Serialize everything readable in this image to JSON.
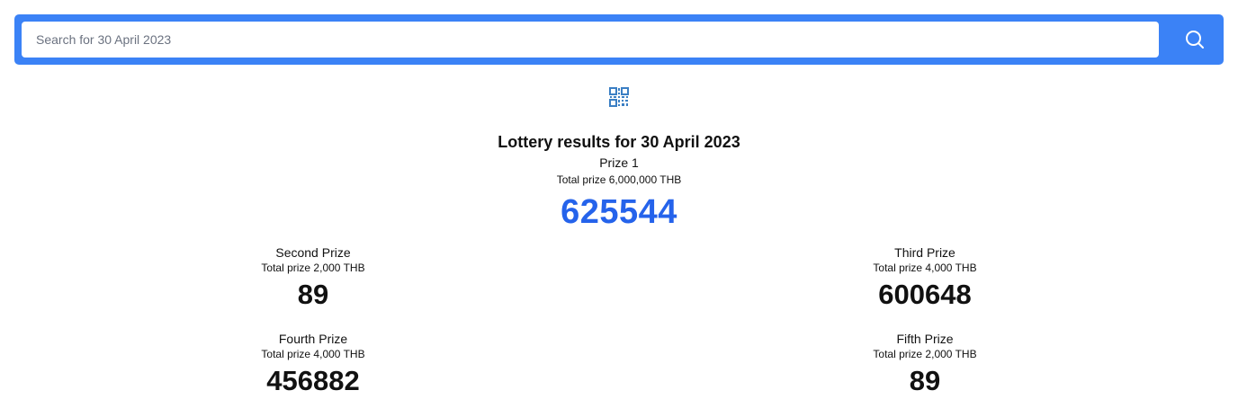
{
  "search": {
    "placeholder": "Search for 30 April 2023",
    "value": ""
  },
  "icons": {
    "search_icon": "search-icon",
    "qr_icon": "qr-code-icon"
  },
  "colors": {
    "accent": "#3b82f6",
    "first_prize_number": "#2563eb"
  },
  "results": {
    "title": "Lottery results for 30 April 2023",
    "first_prize": {
      "label": "Prize 1",
      "total": "Total prize 6,000,000 THB",
      "number": "625544"
    },
    "prizes": [
      {
        "label": "Second Prize",
        "total": "Total prize 2,000 THB",
        "number": "89"
      },
      {
        "label": "Third Prize",
        "total": "Total prize 4,000 THB",
        "number": "600648"
      },
      {
        "label": "Fourth Prize",
        "total": "Total prize 4,000 THB",
        "number": "456882"
      },
      {
        "label": "Fifth Prize",
        "total": "Total prize 2,000 THB",
        "number": "89"
      }
    ]
  }
}
